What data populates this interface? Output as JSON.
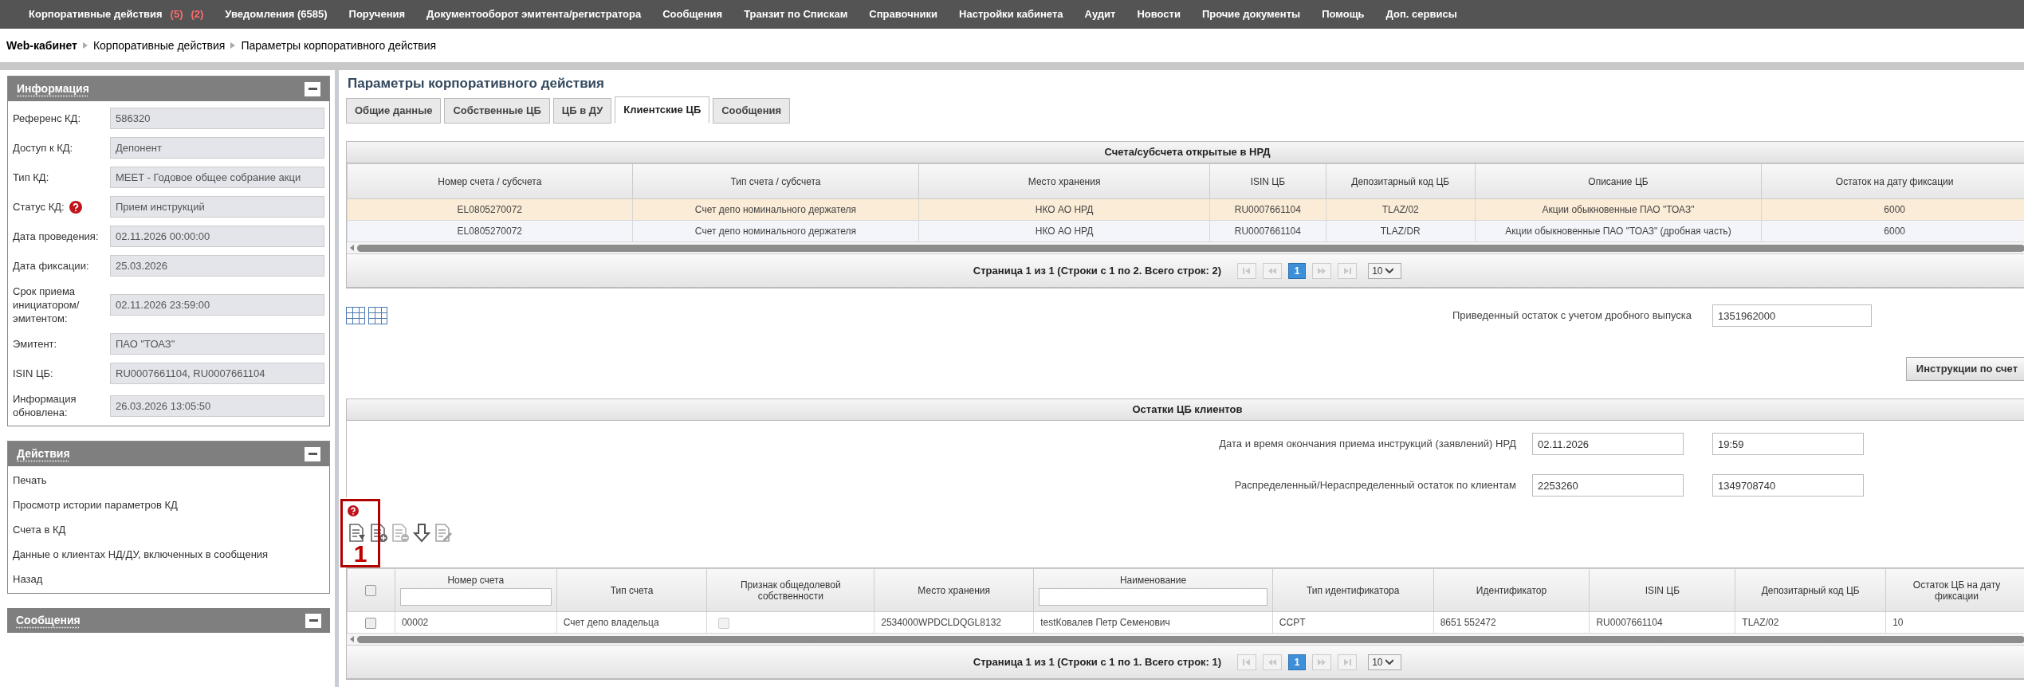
{
  "menu": [
    {
      "label": "Корпоративные действия",
      "badges": [
        "(5)",
        "(2)"
      ]
    },
    {
      "label": "Уведомления (6585)"
    },
    {
      "label": "Поручения"
    },
    {
      "label": "Документооборот эмитента/регистратора"
    },
    {
      "label": "Сообщения"
    },
    {
      "label": "Транзит по Спискам"
    },
    {
      "label": "Справочники"
    },
    {
      "label": "Настройки кабинета"
    },
    {
      "label": "Аудит"
    },
    {
      "label": "Новости"
    },
    {
      "label": "Прочие документы"
    },
    {
      "label": "Помощь"
    },
    {
      "label": "Доп. сервисы"
    }
  ],
  "breadcrumb": [
    "Web-кабинет",
    "Корпоративные действия",
    "Параметры корпоративного действия"
  ],
  "sidebar": {
    "info": {
      "title": "Информация",
      "fields": [
        {
          "label": "Референс КД:",
          "value": "586320",
          "help": false
        },
        {
          "label": "Доступ к КД:",
          "value": "Депонент",
          "help": false
        },
        {
          "label": "Тип КД:",
          "value": "MEET - Годовое общее собрание акци",
          "help": false
        },
        {
          "label": "Статус КД:",
          "value": "Прием инструкций",
          "help": true
        },
        {
          "label": "Дата проведения:",
          "value": "02.11.2026 00:00:00",
          "help": false
        },
        {
          "label": "Дата фиксации:",
          "value": "25.03.2026",
          "help": false
        },
        {
          "label": "Срок приема инициатором/ эмитентом:",
          "value": "02.11.2026 23:59:00",
          "help": false
        },
        {
          "label": "Эмитент:",
          "value": "ПАО \"ТОАЗ\"",
          "help": false
        },
        {
          "label": "ISIN ЦБ:",
          "value": "RU0007661104, RU0007661104",
          "help": false
        },
        {
          "label": "Информация обновлена:",
          "value": "26.03.2026 13:05:50",
          "help": false
        }
      ]
    },
    "actions": {
      "title": "Действия",
      "items": [
        "Печать",
        "Просмотр истории параметров КД",
        "Счета в КД",
        "Данные о клиентах НД/ДУ, включенных в сообщения",
        "Назад"
      ]
    },
    "messages": {
      "title": "Сообщения"
    }
  },
  "main": {
    "title": "Параметры корпоративного действия",
    "tabs": [
      {
        "label": "Общие данные",
        "selected": false
      },
      {
        "label": "Собственные ЦБ",
        "selected": false
      },
      {
        "label": "ЦБ в ДУ",
        "selected": false
      },
      {
        "label": "Клиентские ЦБ",
        "selected": true
      },
      {
        "label": "Сообщения",
        "selected": false
      }
    ],
    "accounts": {
      "caption": "Счета/субсчета открытые в НРД",
      "columns": [
        "Номер счета / субсчета",
        "Тип счета / субсчета",
        "Место хранения",
        "ISIN ЦБ",
        "Депозитарный код ЦБ",
        "Описание ЦБ",
        "Остаток на дату фиксации"
      ],
      "rows": [
        {
          "selected": true,
          "cells": [
            "EL0805270072",
            "Счет депо номинального держателя",
            "НКО АО НРД",
            "RU0007661104",
            "TLAZ/02",
            "Акции обыкновенные ПАО \"ТОАЗ\"",
            "6000"
          ]
        },
        {
          "selected": false,
          "cells": [
            "EL0805270072",
            "Счет депо номинального держателя",
            "НКО АО НРД",
            "RU0007661104",
            "TLAZ/DR",
            "Акции обыкновенные ПАО \"ТОАЗ\" (дробная часть)",
            "6000"
          ]
        }
      ],
      "pager": {
        "text": "Страница 1 из 1 (Строки с 1 по 2. Всего строк: 2)",
        "page": "1",
        "page_size": "10"
      }
    },
    "reduced_balance": {
      "label": "Приведенный остаток с учетом дробного выпуска",
      "value": "1351962000"
    },
    "instructions_button": "Инструкции по счет",
    "client_balances": {
      "caption": "Остатки ЦБ клиентов",
      "deadline": {
        "label": "Дата и время окончания приема инструкций (заявлений) НРД",
        "date": "02.11.2026",
        "time": "19:59"
      },
      "distribution": {
        "label": "Распределенный/Нераспределенный остаток по клиентам",
        "distributed": "2253260",
        "undistributed": "1349708740"
      },
      "select_all": false,
      "columns": [
        {
          "label": "Номер счета",
          "kind": "text",
          "filter": true
        },
        {
          "label": "Тип счета",
          "kind": "text",
          "filter": false
        },
        {
          "label": "Признак общедолевой собственности",
          "kind": "flag",
          "filter": false
        },
        {
          "label": "Место хранения",
          "kind": "text",
          "filter": false
        },
        {
          "label": "Наименование",
          "kind": "text",
          "filter": true
        },
        {
          "label": "Тип идентификатора",
          "kind": "text",
          "filter": false
        },
        {
          "label": "Идентификатор",
          "kind": "text",
          "filter": false
        },
        {
          "label": "ISIN ЦБ",
          "kind": "text",
          "filter": false
        },
        {
          "label": "Депозитарный код ЦБ",
          "kind": "text",
          "filter": false
        },
        {
          "label": "Остаток ЦБ на дату фиксации",
          "kind": "text",
          "filter": false
        }
      ],
      "rows": [
        {
          "checked": false,
          "cells": [
            {
              "text": "00002"
            },
            {
              "text": "Счет депо владельца"
            },
            {
              "checked": false
            },
            {
              "text": "2534000WPDCLDQGL8132"
            },
            {
              "text": "testКовалев Петр Семенович"
            },
            {
              "text": "CCPT"
            },
            {
              "text": "8651 552472"
            },
            {
              "text": "RU0007661104"
            },
            {
              "text": "TLAZ/02"
            },
            {
              "text": "10"
            }
          ]
        }
      ],
      "pager": {
        "text": "Страница 1 из 1 (Строки с 1 по 1. Всего строк: 1)",
        "page": "1",
        "page_size": "10"
      }
    }
  },
  "annotation": {
    "label": "1"
  }
}
